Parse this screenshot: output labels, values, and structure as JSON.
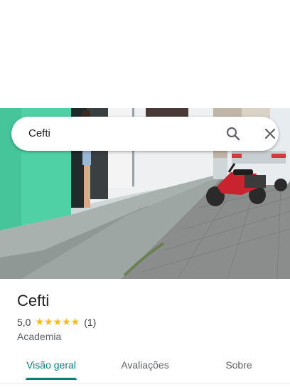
{
  "search": {
    "query": "Cefti"
  },
  "place": {
    "name": "Cefti",
    "rating": "5,0",
    "stars": "★★★★★",
    "review_count": "(1)",
    "category": "Academia"
  },
  "tabs": [
    {
      "label": "Visão geral",
      "active": true
    },
    {
      "label": "Avaliações",
      "active": false
    },
    {
      "label": "Sobre",
      "active": false
    }
  ],
  "colors": {
    "accent": "#0b7f7d",
    "star": "#fbbc04",
    "teal_wall": "#4fd1a5"
  }
}
